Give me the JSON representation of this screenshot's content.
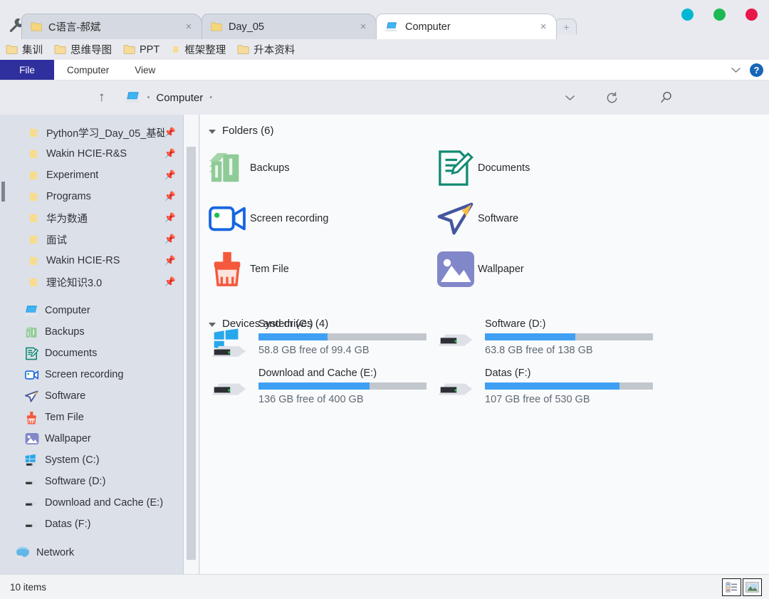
{
  "window": {
    "tools_icon": "wrench-icon",
    "new_tab_label": "+",
    "controls": [
      {
        "name": "minimize",
        "color": "#00b8d4"
      },
      {
        "name": "maximize",
        "color": "#1db954"
      },
      {
        "name": "close",
        "color": "#e8174a"
      }
    ]
  },
  "tabs": [
    {
      "label": "C语言-郝斌",
      "icon": "folder-icon",
      "active": false,
      "close": "×"
    },
    {
      "label": "Day_05",
      "icon": "folder-icon",
      "active": false,
      "close": "×"
    },
    {
      "label": "Computer",
      "icon": "computer-icon",
      "active": true,
      "close": "×"
    }
  ],
  "bookmarks": [
    {
      "label": "集训",
      "icon": "folder-icon"
    },
    {
      "label": "思维导图",
      "icon": "folder-icon"
    },
    {
      "label": "PPT",
      "icon": "folder-icon"
    },
    {
      "label": "框架整理",
      "icon": "folder-icon"
    },
    {
      "label": "升本资料",
      "icon": "folder-icon"
    }
  ],
  "ribbon": {
    "file_label": "File",
    "tabs": [
      {
        "label": "Computer"
      },
      {
        "label": "View"
      }
    ],
    "collapse_icon": "chevron-down-icon",
    "help_label": "?"
  },
  "address": {
    "up_icon": "↑",
    "crumb_icon": "computer-icon",
    "crumb_label": "Computer",
    "sep": "•",
    "history_icon": "chevron-down-icon",
    "refresh_icon": "↻",
    "search_icon": "search-icon",
    "search_placeholder": ""
  },
  "sidebar": {
    "pinned": [
      {
        "label": "Python学习_Day_05_基础",
        "icon": "folder-icon",
        "pinned": true
      },
      {
        "label": "Wakin HCIE-R&S",
        "icon": "folder-icon",
        "pinned": true
      },
      {
        "label": "Experiment",
        "icon": "folder-icon",
        "pinned": true
      },
      {
        "label": "Programs",
        "icon": "folder-icon",
        "pinned": true
      },
      {
        "label": "华为数通",
        "icon": "folder-icon",
        "pinned": true
      },
      {
        "label": "面试",
        "icon": "folder-icon",
        "pinned": true
      },
      {
        "label": "Wakin HCIE-RS",
        "icon": "folder-icon",
        "pinned": true
      },
      {
        "label": "理论知识3.0",
        "icon": "folder-icon",
        "pinned": true
      }
    ],
    "nodes": [
      {
        "label": "Computer",
        "icon": "computer-icon"
      },
      {
        "label": "Backups",
        "icon": "backups-icon"
      },
      {
        "label": "Documents",
        "icon": "documents-icon"
      },
      {
        "label": "Screen recording",
        "icon": "video-camera-icon"
      },
      {
        "label": "Software",
        "icon": "paper-plane-icon"
      },
      {
        "label": "Tem File",
        "icon": "broom-icon"
      },
      {
        "label": "Wallpaper",
        "icon": "picture-icon"
      },
      {
        "label": "System (C:)",
        "icon": "windows-drive-icon"
      },
      {
        "label": "Software (D:)",
        "icon": "drive-icon"
      },
      {
        "label": "Download and Cache (E:)",
        "icon": "drive-icon"
      },
      {
        "label": "Datas (F:)",
        "icon": "drive-icon"
      }
    ],
    "network": {
      "label": "Network",
      "icon": "network-icon"
    }
  },
  "main": {
    "folders_group": {
      "title": "Folders (6)",
      "items": [
        {
          "label": "Backups",
          "icon": "backups-icon"
        },
        {
          "label": "Documents",
          "icon": "documents-icon"
        },
        {
          "label": "Screen recording",
          "icon": "video-camera-icon"
        },
        {
          "label": "Software",
          "icon": "paper-plane-icon"
        },
        {
          "label": "Tem File",
          "icon": "broom-icon"
        },
        {
          "label": "Wallpaper",
          "icon": "picture-icon"
        }
      ]
    },
    "drives_group": {
      "title": "Devices and drives (4)",
      "items": [
        {
          "label": "System (C:)",
          "free_text": "58.8 GB free of 99.4 GB",
          "used_percent": 41,
          "icon": "windows-drive-icon"
        },
        {
          "label": "Software (D:)",
          "free_text": "63.8 GB free of 138 GB",
          "used_percent": 54,
          "icon": "drive-icon"
        },
        {
          "label": "Download and Cache (E:)",
          "free_text": "136 GB free of 400 GB",
          "used_percent": 66,
          "icon": "drive-icon"
        },
        {
          "label": "Datas (F:)",
          "free_text": "107 GB free of 530 GB",
          "used_percent": 80,
          "icon": "drive-icon"
        }
      ]
    }
  },
  "status": {
    "items_text": "10 items",
    "view_buttons": [
      {
        "name": "details-view-button",
        "active": false
      },
      {
        "name": "large-icons-view-button",
        "active": true
      }
    ]
  },
  "colors": {
    "accent_file_tab": "#2f2f9e",
    "progress_fill": "#3fa0f3",
    "progress_track": "#c2c7cd",
    "chrome_bg": "#e8eaef",
    "sidebar_bg": "#dce0e8",
    "content_bg": "#f9fafb"
  }
}
